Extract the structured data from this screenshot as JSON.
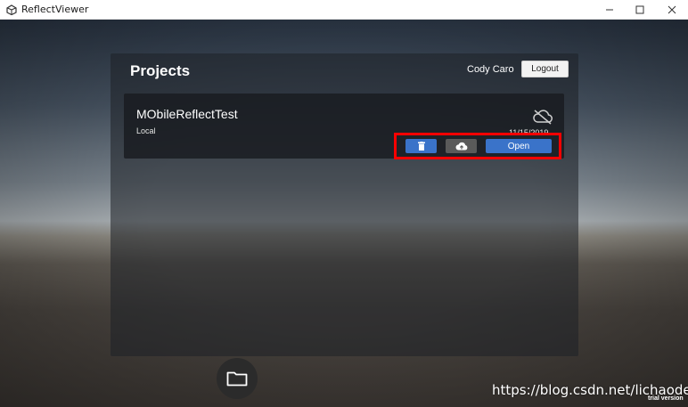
{
  "window": {
    "title": "ReflectViewer",
    "icon": "unity-icon",
    "controls": [
      "minimize-icon",
      "maximize-icon",
      "close-icon"
    ]
  },
  "panel": {
    "title": "Projects",
    "user_name": "Cody Caro",
    "logout_label": "Logout"
  },
  "project": {
    "name": "MObileReflectTest",
    "source": "Local",
    "date": "11/15/2019",
    "status_icon": "cloud-off-icon",
    "delete_icon": "trash-icon",
    "upload_icon": "cloud-upload-icon",
    "open_label": "Open"
  },
  "footer": {
    "folder_icon": "folder-icon",
    "watermark": "https://blog.csdn.net/lichaoder",
    "trial_label": "trial version"
  },
  "colors": {
    "accent": "#3a73c9",
    "highlight": "#ff0000",
    "panel_bg": "#1e2126"
  }
}
